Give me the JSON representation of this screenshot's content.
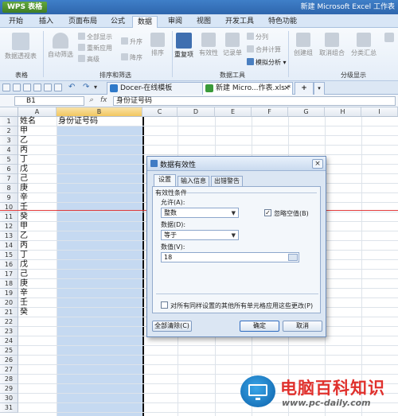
{
  "app": {
    "menu_button": "WPS 表格",
    "window_title": "新建 Microsoft Excel 工作表"
  },
  "ribbon_tabs": [
    "开始",
    "插入",
    "页面布局",
    "公式",
    "数据",
    "审阅",
    "视图",
    "开发工具",
    "特色功能"
  ],
  "active_ribbon_tab": "数据",
  "ribbon": {
    "pivot": "数据透视表",
    "autofilter": "自动筛选",
    "filter_all": "全部显示",
    "reapply": "重新应用",
    "advanced": "高级",
    "sort_asc": "升序",
    "sort_desc": "降序",
    "sort": "排序",
    "duplicates": "重复项",
    "validation": "有效性",
    "record_form": "记录单",
    "split": "分列",
    "consolidate": "合并计算",
    "what_if": "模拟分析",
    "create_group": "创建组",
    "ungroup": "取消组合",
    "subtotal": "分类汇总",
    "group_table": "表格",
    "group_sort_filter": "排序和筛选",
    "group_data_tools": "数据工具",
    "group_outline": "分级显示"
  },
  "doc_tabs": [
    {
      "label": "Docer-在线模板",
      "active": false
    },
    {
      "label": "新建 Micro...作表.xls *",
      "active": true
    }
  ],
  "formula_bar": {
    "name_box": "B1",
    "fx": "fx",
    "content": "身份证号码"
  },
  "columns": [
    "A",
    "B",
    "C",
    "D",
    "E",
    "F",
    "G",
    "H",
    "I"
  ],
  "selected_column": "B",
  "rows": [
    "1",
    "2",
    "3",
    "4",
    "5",
    "6",
    "7",
    "8",
    "9",
    "10",
    "11",
    "12",
    "13",
    "14",
    "15",
    "16",
    "17",
    "18",
    "19",
    "20",
    "21",
    "22",
    "23",
    "24",
    "25",
    "26",
    "27",
    "28",
    "29",
    "30",
    "31"
  ],
  "column_a_values": [
    "姓名",
    "甲",
    "乙",
    "丙",
    "丁",
    "戊",
    "己",
    "庚",
    "辛",
    "壬",
    "癸",
    "甲",
    "乙",
    "丙",
    "丁",
    "戊",
    "己",
    "庚",
    "辛",
    "壬",
    "癸"
  ],
  "b1_value": "身份证号码",
  "dialog": {
    "title": "数据有效性",
    "close": "×",
    "tabs": [
      "设置",
      "输入信息",
      "出错警告"
    ],
    "active_tab": "设置",
    "criteria_label": "有效性条件",
    "allow_label": "允许(A):",
    "allow_value": "整数",
    "ignore_blank_label": "忽略空值(B)",
    "ignore_blank_checked": true,
    "data_label": "数据(D):",
    "data_value": "等于",
    "value_label": "数值(V):",
    "value_value": "18",
    "apply_all_label": "对所有同样设置的其他所有单元格应用这些更改(P)",
    "apply_all_checked": false,
    "clear_all_button": "全部清除(C)",
    "ok_button": "确定",
    "cancel_button": "取消"
  },
  "watermark": {
    "name": "电脑百科知识",
    "url": "www.pc-daily.com"
  }
}
